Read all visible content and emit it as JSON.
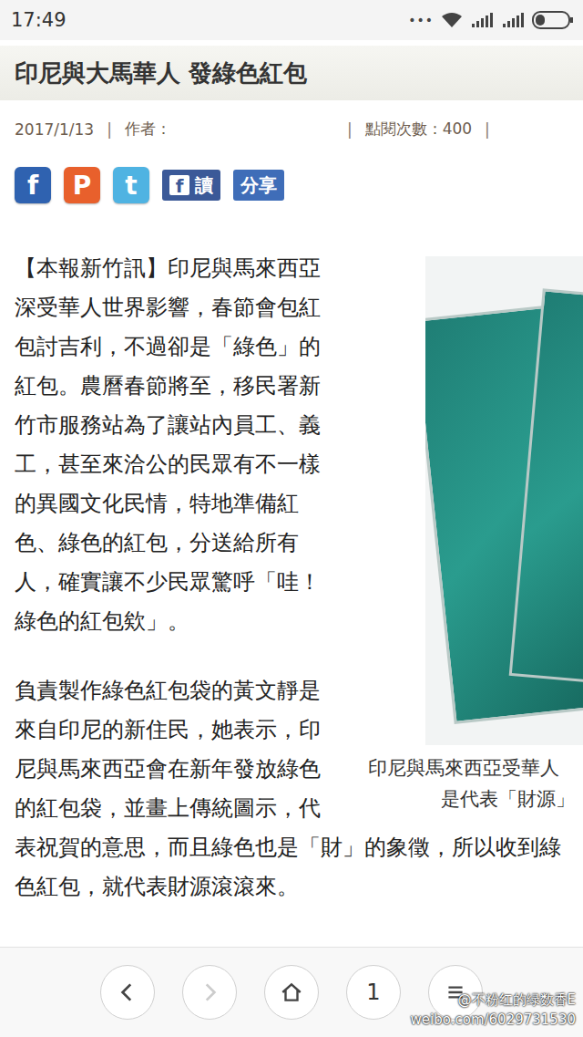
{
  "status_bar": {
    "time": "17:49",
    "dots": "•••"
  },
  "article": {
    "title": "印尼與大馬華人 發綠色紅包",
    "date": "2017/1/13",
    "separator": "|",
    "author_label": "作者：",
    "views_label": "點閱次數：",
    "views": "400"
  },
  "share_buttons": [
    {
      "glyph": "f",
      "label": "",
      "kind": "icon",
      "color": "#2f62b0"
    },
    {
      "glyph": "P",
      "label": "",
      "kind": "icon",
      "color": "#e8602c"
    },
    {
      "glyph": "t",
      "label": "",
      "kind": "icon",
      "color": "#4fb3e2"
    },
    {
      "glyph": "f",
      "label": "讀",
      "kind": "button",
      "color": "#3b5998"
    },
    {
      "glyph": "",
      "label": "分享",
      "kind": "button",
      "color": "#3f6db8"
    }
  ],
  "paragraphs": [
    "【本報新竹訊】印尼與馬來西亞深受華人世界影響，春節會包紅包討吉利，不過卻是「綠色」的紅包。農曆春節將至，移民署新竹市服務站為了讓站內員工、義工，甚至來洽公的民眾有不一樣的異國文化民情，特地準備紅色、綠色的紅包，分送給所有人，確實讓不少民眾驚呼「哇！綠色的紅包欸」。",
    "負責製作綠色紅包袋的黃文靜是來自印尼的新住民，她表示，印尼與馬來西亞會在新年發放綠色的紅包袋，並畫上傳統圖示，代表祝賀的意思，而且綠色也是「財」的象徵，所以收到綠色紅包，就代表財源滾滾來。"
  ],
  "image_caption": [
    "印尼與馬來西亞受華人",
    "是代表「財源」"
  ],
  "nav_buttons": [
    {
      "kind": "back",
      "label": "",
      "disabled": false
    },
    {
      "kind": "forward",
      "label": "",
      "disabled": true
    },
    {
      "kind": "home",
      "label": "",
      "disabled": false
    },
    {
      "kind": "tabs",
      "label": "1",
      "disabled": false
    },
    {
      "kind": "menu",
      "label": "",
      "disabled": false
    }
  ],
  "watermark": [
    "@不粉红的绿数香E",
    "weibo.com/6029731530"
  ]
}
